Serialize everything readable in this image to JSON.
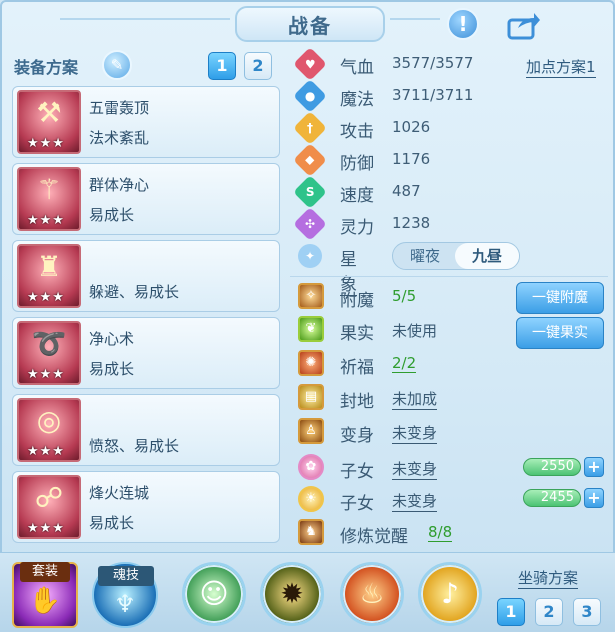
{
  "header": {
    "title": "战备",
    "help_icon": "exclamation-icon",
    "share_icon": "share-arrow-icon"
  },
  "left": {
    "plan_label": "装备方案",
    "edit_icon": "pencil-icon",
    "plan_tabs": [
      "1",
      "2"
    ],
    "equipment": [
      {
        "name": "五雷轰顶",
        "skill": "法术紊乱",
        "stars": "★★★",
        "icon": "hammer-icon"
      },
      {
        "name": "群体净心",
        "skill": "易成长",
        "stars": "★★★",
        "icon": "staff-icon"
      },
      {
        "name": "",
        "skill": "躲避、易成长",
        "stars": "★★★",
        "icon": "armor-icon"
      },
      {
        "name": "净心术",
        "skill": "易成长",
        "stars": "★★★",
        "icon": "necklace-icon"
      },
      {
        "name": "",
        "skill": "愤怒、易成长",
        "stars": "★★★",
        "icon": "belt-icon"
      },
      {
        "name": "烽火连城",
        "skill": "易成长",
        "stars": "★★★",
        "icon": "boots-icon"
      }
    ]
  },
  "stats": [
    {
      "label": "气血",
      "value": "3577/3577",
      "color": "#e0566d",
      "glyph": "♥"
    },
    {
      "label": "魔法",
      "value": "3711/3711",
      "color": "#3f9be2",
      "glyph": "●"
    },
    {
      "label": "攻击",
      "value": "1026",
      "color": "#f0b43a",
      "glyph": "†"
    },
    {
      "label": "防御",
      "value": "1176",
      "color": "#f08d4a",
      "glyph": "◆"
    },
    {
      "label": "速度",
      "value": "487",
      "color": "#2fc38a",
      "glyph": "S"
    },
    {
      "label": "灵力",
      "value": "1238",
      "color": "#b56ee0",
      "glyph": "✣"
    }
  ],
  "add_plan": "加点方案1",
  "star_sign": {
    "label": "星象",
    "options": [
      "曜夜",
      "九昼"
    ],
    "selected": "九昼"
  },
  "features": [
    {
      "label": "附魔",
      "value": "5/5",
      "style": "green",
      "button": "一键附魔"
    },
    {
      "label": "果实",
      "value": "未使用",
      "style": "dark",
      "button": "一键果实"
    },
    {
      "label": "祈福",
      "value": "2/2",
      "style": "green-ul"
    },
    {
      "label": "封地",
      "value": "未加成",
      "style": "dark-ul"
    },
    {
      "label": "变身",
      "value": "未变身",
      "style": "dark-ul"
    },
    {
      "label": "子女",
      "value": "未变身",
      "style": "dark-ul",
      "bar": "2550"
    },
    {
      "label": "子女",
      "value": "未变身",
      "style": "dark-ul",
      "bar": "2455"
    },
    {
      "label": "修炼觉醒",
      "value": "8/8",
      "style": "green-ul"
    }
  ],
  "bottom": {
    "suit_label": "套装",
    "soul_label": "魂技",
    "mount_label": "坐骑方案",
    "mount_tabs": [
      "1",
      "2",
      "3"
    ]
  }
}
